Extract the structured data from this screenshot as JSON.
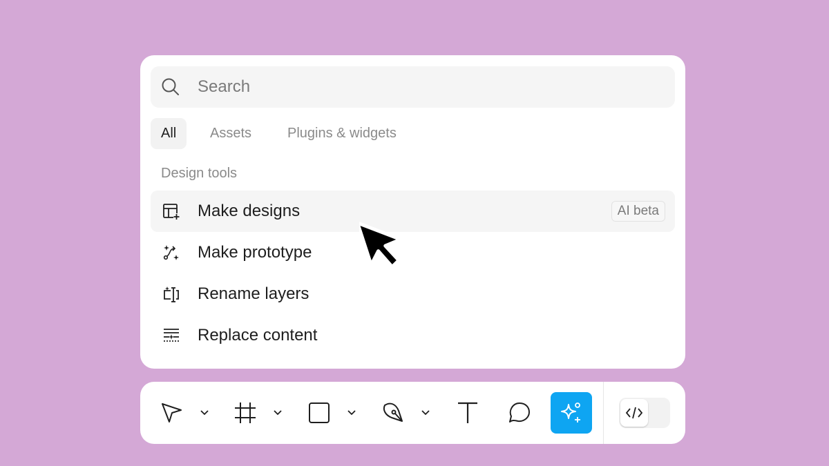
{
  "search": {
    "placeholder": "Search",
    "icon": "search-icon"
  },
  "tabs": [
    {
      "label": "All",
      "active": true
    },
    {
      "label": "Assets",
      "active": false
    },
    {
      "label": "Plugins & widgets",
      "active": false
    }
  ],
  "section": {
    "label": "Design tools"
  },
  "items": [
    {
      "label": "Make designs",
      "icon": "layout-plus-icon",
      "badge": "AI beta",
      "highlighted": true
    },
    {
      "label": "Make prototype",
      "icon": "prototype-sparkle-icon"
    },
    {
      "label": "Rename layers",
      "icon": "rename-icon"
    },
    {
      "label": "Replace content",
      "icon": "replace-content-icon"
    }
  ],
  "toolbar": {
    "tools": [
      "move-tool",
      "frame-tool",
      "shape-tool",
      "pen-tool",
      "text-tool",
      "comment-tool",
      "ai-tool"
    ],
    "active_tool": "ai-tool",
    "accent_color": "#0EA5F2",
    "dev_mode_icon": "code-icon"
  },
  "colors": {
    "background": "#D4A8D6",
    "panel": "#FFFFFF",
    "accent": "#0EA5F2"
  }
}
